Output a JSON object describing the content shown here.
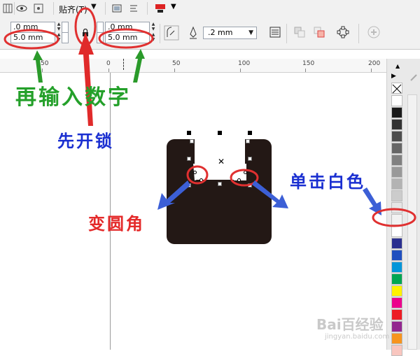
{
  "toolbar": {
    "snap_label": "贴齐(T)",
    "icons": [
      "view-icon",
      "wireframe-icon",
      "snap-dropdown-icon",
      "options-icon",
      "align-icon",
      "color-swatch-icon"
    ]
  },
  "property_bar": {
    "corner_top_left": ".0 mm",
    "corner_bottom_left": "5.0 mm",
    "corner_top_right": ".0 mm",
    "corner_bottom_right": "5.0 mm",
    "outline_width": ".2 mm"
  },
  "ruler": {
    "labels": [
      "50",
      "0",
      "50",
      "100",
      "150",
      "200"
    ]
  },
  "palette": {
    "colors": [
      "#ffffff",
      "#1a1a1a",
      "#333333",
      "#4d4d4d",
      "#666666",
      "#808080",
      "#999999",
      "#b3b3b3",
      "#cccccc",
      "#e6e6e6",
      "#f2f2f2",
      "#ffffff",
      "#2b2f8f",
      "#1f4fbf",
      "#0095d9",
      "#00a651",
      "#fff200",
      "#ec008c",
      "#ed1c24",
      "#92278f",
      "#f7941d",
      "#f9c6bf"
    ]
  },
  "annotations": {
    "enter_number": "再输入数字",
    "unlock_first": "先开锁",
    "round_corner": "变圆角",
    "click_white": "单击白色"
  },
  "watermark": {
    "main": "Bai百经验",
    "sub": "jingyan.baidu.com"
  },
  "colors": {
    "green_annotation": "#24a02a",
    "blue_annotation": "#1a2fd1",
    "red_annotation": "#e42a2a",
    "shape_fill": "#231815"
  }
}
